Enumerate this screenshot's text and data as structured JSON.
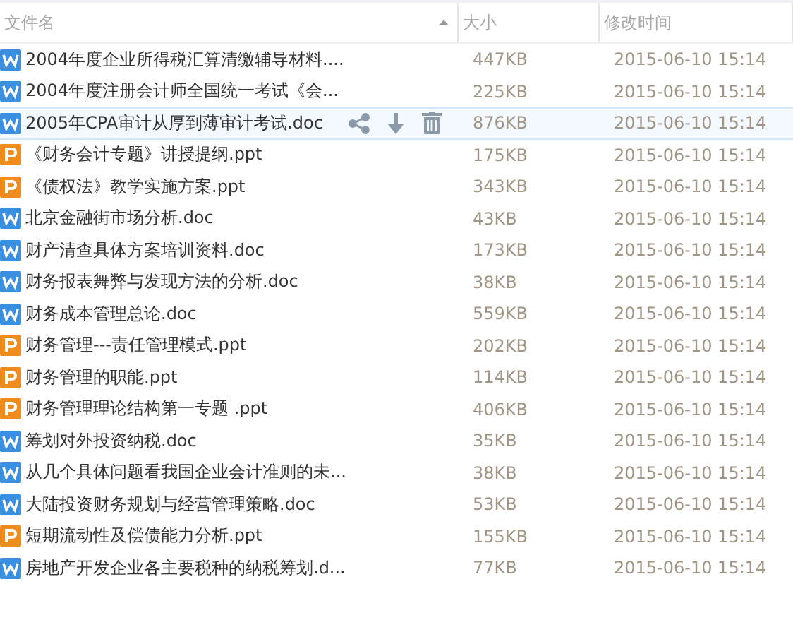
{
  "columns": [
    {
      "label": "文件名",
      "sorted": true
    },
    {
      "label": "大小",
      "sorted": false
    },
    {
      "label": "修改时间",
      "sorted": false
    }
  ],
  "rows": [
    {
      "kind": "doc",
      "name": "2004年度企业所得税汇算清缴辅导材料....",
      "size": "447KB",
      "modified": "2015-06-10 15:14",
      "selected": false
    },
    {
      "kind": "doc",
      "name": "2004年度注册会计师全国统一考试《会...",
      "size": "225KB",
      "modified": "2015-06-10 15:14",
      "selected": false
    },
    {
      "kind": "doc",
      "name": "2005年CPA审计从厚到薄审计考试.doc",
      "size": "876KB",
      "modified": "2015-06-10 15:14",
      "selected": true
    },
    {
      "kind": "ppt",
      "name": "《财务会计专题》讲授提纲.ppt",
      "size": "175KB",
      "modified": "2015-06-10 15:14",
      "selected": false
    },
    {
      "kind": "ppt",
      "name": "《债权法》教学实施方案.ppt",
      "size": "343KB",
      "modified": "2015-06-10 15:14",
      "selected": false
    },
    {
      "kind": "doc",
      "name": "北京金融街市场分析.doc",
      "size": "43KB",
      "modified": "2015-06-10 15:14",
      "selected": false
    },
    {
      "kind": "doc",
      "name": "财产清查具体方案培训资料.doc",
      "size": "173KB",
      "modified": "2015-06-10 15:14",
      "selected": false
    },
    {
      "kind": "doc",
      "name": "财务报表舞弊与发现方法的分析.doc",
      "size": "38KB",
      "modified": "2015-06-10 15:14",
      "selected": false
    },
    {
      "kind": "doc",
      "name": "财务成本管理总论.doc",
      "size": "559KB",
      "modified": "2015-06-10 15:14",
      "selected": false
    },
    {
      "kind": "ppt",
      "name": "财务管理---责任管理模式.ppt",
      "size": "202KB",
      "modified": "2015-06-10 15:14",
      "selected": false
    },
    {
      "kind": "ppt",
      "name": "财务管理的职能.ppt",
      "size": "114KB",
      "modified": "2015-06-10 15:14",
      "selected": false
    },
    {
      "kind": "ppt",
      "name": "财务管理理论结构第一专题 .ppt",
      "size": "406KB",
      "modified": "2015-06-10 15:14",
      "selected": false
    },
    {
      "kind": "doc",
      "name": "筹划对外投资纳税.doc",
      "size": "35KB",
      "modified": "2015-06-10 15:14",
      "selected": false
    },
    {
      "kind": "doc",
      "name": "从几个具体问题看我国企业会计准则的未...",
      "size": "38KB",
      "modified": "2015-06-10 15:14",
      "selected": false
    },
    {
      "kind": "doc",
      "name": "大陆投资财务规划与经营管理策略.doc",
      "size": "53KB",
      "modified": "2015-06-10 15:14",
      "selected": false
    },
    {
      "kind": "ppt",
      "name": "短期流动性及偿债能力分析.ppt",
      "size": "155KB",
      "modified": "2015-06-10 15:14",
      "selected": false
    },
    {
      "kind": "doc",
      "name": "房地产开发企业各主要税种的纳税筹划.d...",
      "size": "77KB",
      "modified": "2015-06-10 15:14",
      "selected": false
    }
  ]
}
